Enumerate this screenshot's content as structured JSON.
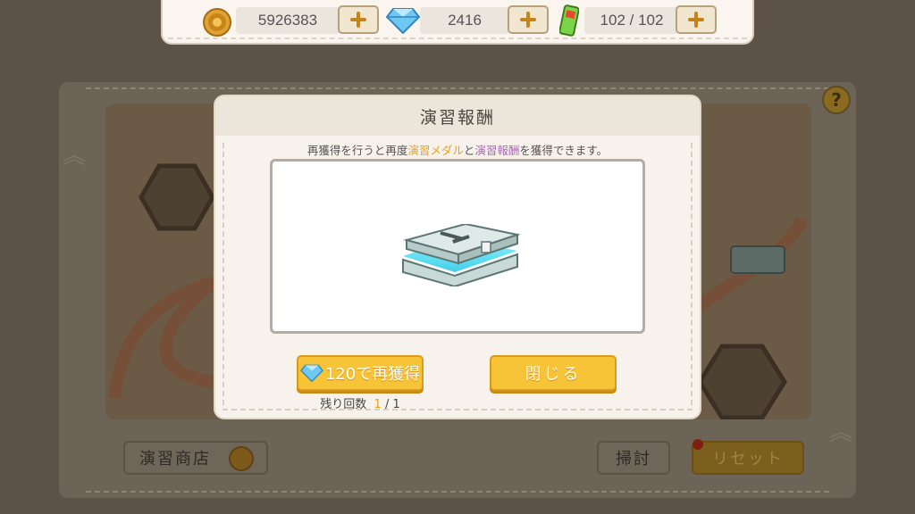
{
  "currency": {
    "coins": "5926383",
    "gems": "2416",
    "stamina": "102 / 102"
  },
  "modal": {
    "title": "演習報酬",
    "desc_prefix": "再獲得を行うと再度",
    "desc_highlight1": "演習メダル",
    "desc_mid": "と",
    "desc_highlight2": "演習報酬",
    "desc_suffix": "を獲得できます。",
    "reacquire_label": "120で再獲得",
    "close_label": "閉じる",
    "remaining_label": "残り回数",
    "remaining_current": "1",
    "remaining_total": "/ 1"
  },
  "bottom": {
    "shop_label": "演習商店",
    "sweep_label": "掃討",
    "reset_label": "リセット"
  },
  "help_label": "?",
  "colors": {
    "accent_gold": "#f7c437",
    "highlight_orange": "#e8a11c",
    "highlight_purple": "#b35fc4"
  },
  "icons": [
    "coin-icon",
    "gem-icon",
    "stamina-icon",
    "plus-icon",
    "treasure-chest-icon",
    "help-icon"
  ]
}
